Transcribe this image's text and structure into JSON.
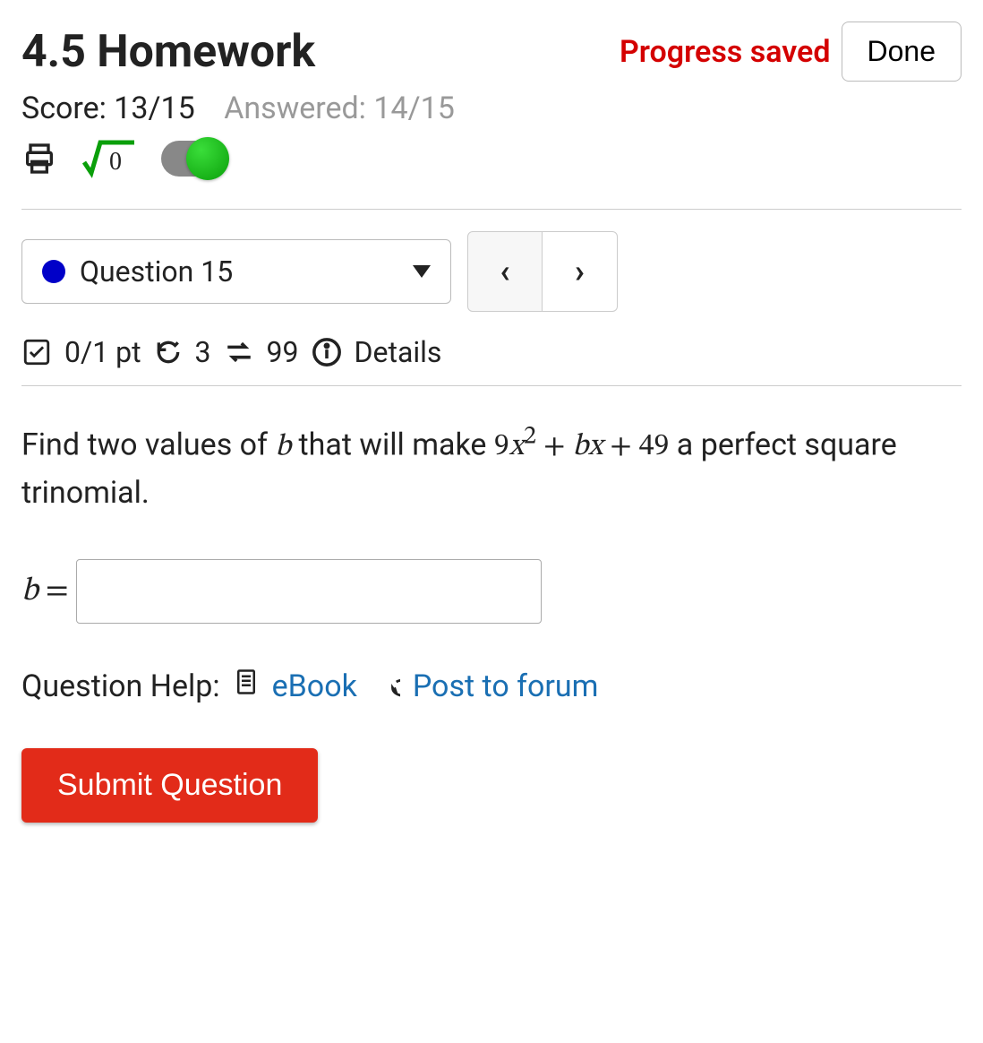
{
  "header": {
    "title": "4.5 Homework",
    "progress_saved": "Progress saved",
    "done": "Done"
  },
  "score": {
    "label": "Score: 13/15",
    "answered": "Answered: 14/15"
  },
  "question_nav": {
    "current": "Question 15",
    "prev_glyph": "‹",
    "next_glyph": "›"
  },
  "meta": {
    "points": "0/1 pt",
    "retries": "3",
    "attempts": "99",
    "details": "Details"
  },
  "question": {
    "prompt_pre": "Find two values of ",
    "var_b": "b",
    "prompt_mid": " that will make ",
    "expr_9": "9",
    "expr_x": "x",
    "expr_sup": "2",
    "expr_plus1": " + ",
    "expr_b": "b",
    "expr_x2": "x",
    "expr_plus2": " + ",
    "expr_49": "49",
    "prompt_post": " a perfect square trinomial."
  },
  "answer": {
    "label_b": "b",
    "label_eq": " = ",
    "value": ""
  },
  "help": {
    "label": "Question Help:",
    "ebook": "eBook",
    "forum": "Post to forum"
  },
  "submit": "Submit Question"
}
